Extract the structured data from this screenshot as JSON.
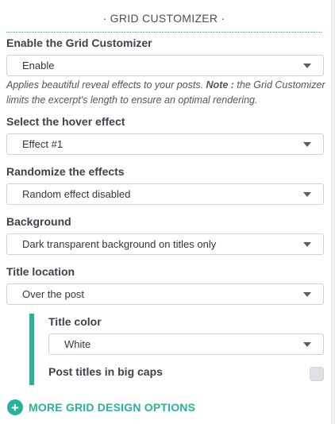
{
  "section": {
    "title": "· GRID CUSTOMIZER ·"
  },
  "enable": {
    "label": "Enable the Grid Customizer",
    "value": "Enable",
    "desc_prefix": "Applies beautiful reveal effects to your posts. ",
    "desc_note": "Note :",
    "desc_suffix": " the Grid Customizer limits the excerpt's length to ensure an optimal rendering."
  },
  "hover_effect": {
    "label": "Select the hover effect",
    "value": "Effect #1"
  },
  "randomize": {
    "label": "Randomize the effects",
    "value": "Random effect disabled"
  },
  "background": {
    "label": "Background",
    "value": "Dark transparent background on titles only"
  },
  "title_location": {
    "label": "Title location",
    "value": "Over the post"
  },
  "title_color": {
    "label": "Title color",
    "value": "White"
  },
  "big_caps": {
    "label": "Post titles in big caps",
    "checked": false
  },
  "more_options": {
    "label": "MORE GRID DESIGN OPTIONS",
    "icon": "plus-circle-icon"
  },
  "colors": {
    "accent": "#27b399"
  }
}
